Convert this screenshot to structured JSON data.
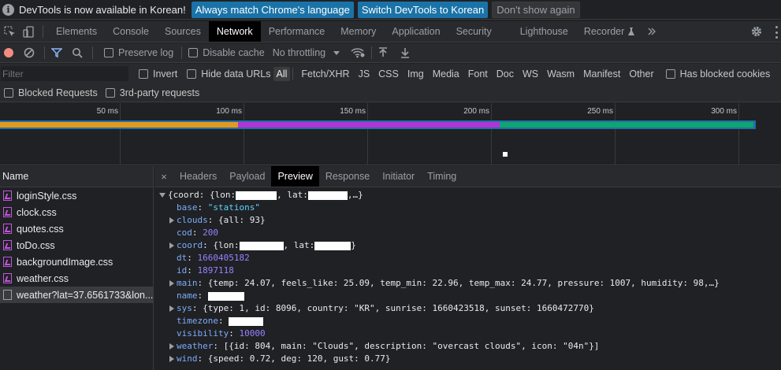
{
  "infobar": {
    "message": "DevTools is now available in Korean!",
    "btn_match": "Always match Chrome's language",
    "btn_switch": "Switch DevTools to Korean",
    "btn_dismiss": "Don't show again"
  },
  "tabs": [
    "Elements",
    "Console",
    "Sources",
    "Network",
    "Performance",
    "Memory",
    "Application",
    "Security",
    "Lighthouse",
    "Recorder"
  ],
  "active_tab": "Network",
  "toolbar": {
    "preserve_log": "Preserve log",
    "disable_cache": "Disable cache",
    "throttling": "No throttling"
  },
  "filter": {
    "placeholder": "Filter",
    "invert": "Invert",
    "hide_data_urls": "Hide data URLs",
    "types": [
      "All",
      "Fetch/XHR",
      "JS",
      "CSS",
      "Img",
      "Media",
      "Font",
      "Doc",
      "WS",
      "Wasm",
      "Manifest",
      "Other"
    ],
    "has_blocked_cookies": "Has blocked cookies",
    "blocked_requests": "Blocked Requests",
    "third_party": "3rd-party requests"
  },
  "timeline": {
    "ticks": [
      "50 ms",
      "100 ms",
      "150 ms",
      "200 ms",
      "250 ms",
      "300 ms"
    ]
  },
  "requests": {
    "header": "Name",
    "items": [
      {
        "name": "loginStyle.css",
        "type": "css"
      },
      {
        "name": "clock.css",
        "type": "css"
      },
      {
        "name": "quotes.css",
        "type": "css"
      },
      {
        "name": "toDo.css",
        "type": "css"
      },
      {
        "name": "backgroundImage.css",
        "type": "css"
      },
      {
        "name": "weather.css",
        "type": "css"
      },
      {
        "name": "weather?lat=37.6561733&lon...",
        "type": "doc",
        "selected": true
      }
    ]
  },
  "detail": {
    "close": "×",
    "tabs": [
      "Headers",
      "Payload",
      "Preview",
      "Response",
      "Initiator",
      "Timing"
    ],
    "active": "Preview"
  },
  "preview": {
    "root_open": "{coord: {lon: ",
    "root_lat": ", lat: ",
    "root_close": ",…}",
    "base_key": "base",
    "base_val": "\"stations\"",
    "clouds_key": "clouds",
    "clouds_val": "{all: 93}",
    "cod_key": "cod",
    "cod_val": "200",
    "coord_key": "coord",
    "coord_open": "{lon: ",
    "coord_lat": ", lat: ",
    "coord_close": "}",
    "dt_key": "dt",
    "dt_val": "1660405182",
    "id_key": "id",
    "id_val": "1897118",
    "main_key": "main",
    "main_val": "{temp: 24.07, feels_like: 25.09, temp_min: 22.96, temp_max: 24.77, pressure: 1007, humidity: 98,…}",
    "name_key": "name",
    "sys_key": "sys",
    "sys_val": "{type: 1, id: 8096, country: \"KR\", sunrise: 1660423518, sunset: 1660472770}",
    "timezone_key": "timezone",
    "visibility_key": "visibility",
    "visibility_val": "10000",
    "weather_key": "weather",
    "weather_val": "[{id: 804, main: \"Clouds\", description: \"overcast clouds\", icon: \"04n\"}]",
    "wind_key": "wind",
    "wind_val": "{speed: 0.72, deg: 120, gust: 0.77}"
  },
  "colors": {
    "accent": "#1a73a8",
    "bar_orange": "#e19a1f",
    "bar_purple": "#b034d6",
    "bar_green": "#0ea572",
    "record": "#f28b82"
  }
}
